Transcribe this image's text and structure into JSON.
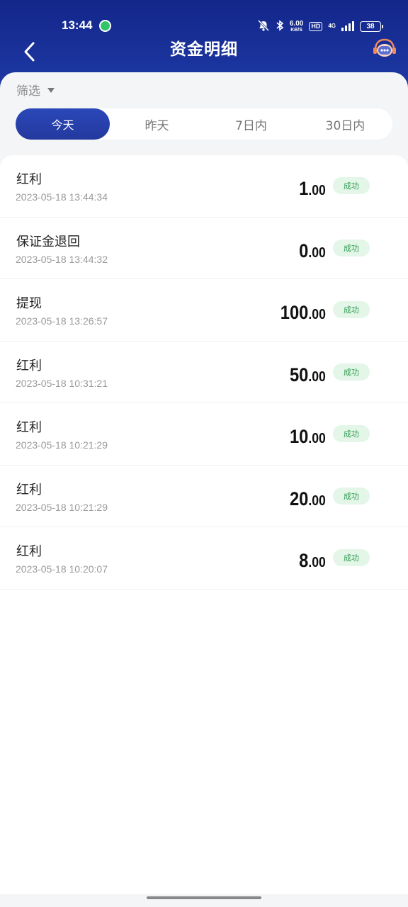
{
  "status_bar": {
    "time": "13:44",
    "net_speed_value": "6.00",
    "net_speed_unit": "KB/S",
    "hd_label": "HD",
    "network_label": "4G",
    "battery": "38"
  },
  "nav": {
    "title": "资金明细"
  },
  "filter": {
    "label": "筛选"
  },
  "tabs": [
    {
      "label": "今天",
      "active": true
    },
    {
      "label": "昨天",
      "active": false
    },
    {
      "label": "7日内",
      "active": false
    },
    {
      "label": "30日内",
      "active": false
    }
  ],
  "records": [
    {
      "title": "红利",
      "time": "2023-05-18 13:44:34",
      "amount_int": "1",
      "amount_dec": ".00",
      "status": "成功"
    },
    {
      "title": "保证金退回",
      "time": "2023-05-18 13:44:32",
      "amount_int": "0",
      "amount_dec": ".00",
      "status": "成功"
    },
    {
      "title": "提现",
      "time": "2023-05-18 13:26:57",
      "amount_int": "100",
      "amount_dec": ".00",
      "status": "成功"
    },
    {
      "title": "红利",
      "time": "2023-05-18 10:31:21",
      "amount_int": "50",
      "amount_dec": ".00",
      "status": "成功"
    },
    {
      "title": "红利",
      "time": "2023-05-18 10:21:29",
      "amount_int": "10",
      "amount_dec": ".00",
      "status": "成功"
    },
    {
      "title": "红利",
      "time": "2023-05-18 10:21:29",
      "amount_int": "20",
      "amount_dec": ".00",
      "status": "成功"
    },
    {
      "title": "红利",
      "time": "2023-05-18 10:20:07",
      "amount_int": "8",
      "amount_dec": ".00",
      "status": "成功"
    }
  ],
  "colors": {
    "header": "#1a31a0",
    "active_tab": "#2b48b8",
    "success_bg": "#e3f6e8",
    "success_text": "#2f9a4f"
  }
}
